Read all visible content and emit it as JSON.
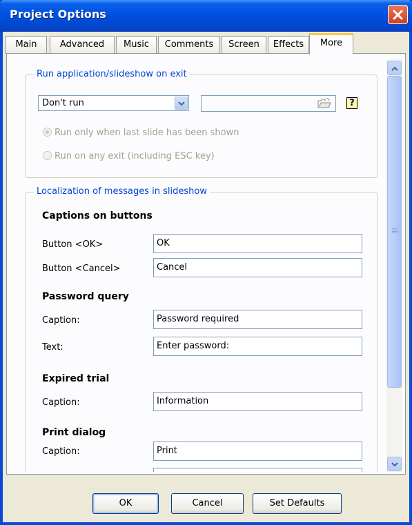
{
  "window": {
    "title": "Project Options"
  },
  "tabs": [
    {
      "label": "Main"
    },
    {
      "label": "Advanced"
    },
    {
      "label": "Music"
    },
    {
      "label": "Comments"
    },
    {
      "label": "Screen"
    },
    {
      "label": "Effects"
    },
    {
      "label": "More"
    }
  ],
  "active_tab": "More",
  "run_group": {
    "title": "Run application/slideshow on exit",
    "combo_value": "Don't run",
    "path_value": "",
    "help_glyph": "?",
    "radio_last_slide": "Run only when last slide has been shown",
    "radio_any_exit": "Run on any exit (including ESC key)"
  },
  "localization": {
    "title": "Localization of messages in slideshow",
    "captions_heading": "Captions on buttons",
    "ok_label": "Button <OK>",
    "ok_value": "OK",
    "cancel_label": "Button <Cancel>",
    "cancel_value": "Cancel",
    "password_heading": "Password query",
    "pw_caption_label": "Caption:",
    "pw_caption_value": "Password required",
    "pw_text_label": "Text:",
    "pw_text_value": "Enter password:",
    "expired_heading": "Expired trial",
    "exp_caption_label": "Caption:",
    "exp_caption_value": "Information",
    "print_heading": "Print dialog",
    "print_caption_label": "Caption:",
    "print_caption_value": "Print"
  },
  "buttons": {
    "ok": "OK",
    "cancel": "Cancel",
    "defaults": "Set Defaults"
  },
  "colors": {
    "titlebar": "#0054e3",
    "group_title": "#0046d5",
    "tab_highlight": "#ffc83c"
  }
}
